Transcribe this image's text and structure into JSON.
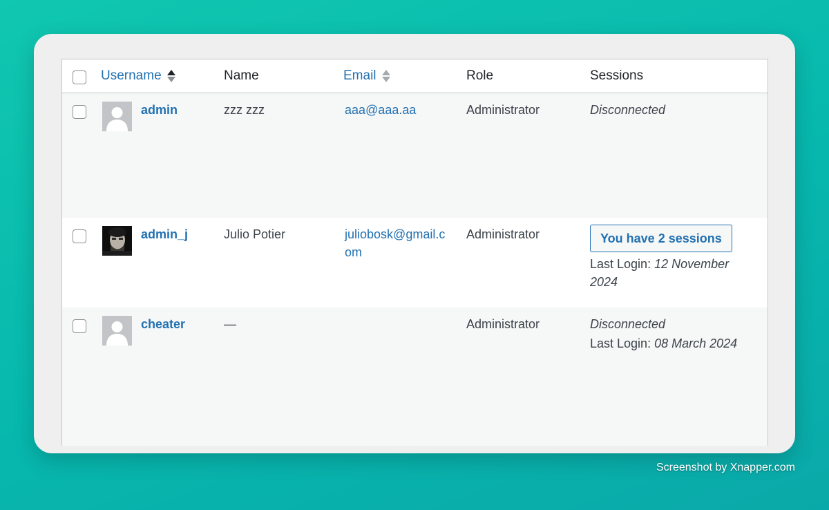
{
  "columns": {
    "username": "Username",
    "name": "Name",
    "email": "Email",
    "role": "Role",
    "sessions": "Sessions"
  },
  "rows": [
    {
      "username": "admin",
      "name": "zzz zzz",
      "email": "aaa@aaa.aa",
      "role": "Administrator",
      "session_status": "Disconnected"
    },
    {
      "username": "admin_j",
      "name": "Julio Potier",
      "email": "juliobosk@gmail.com",
      "role": "Administrator",
      "session_button": "You have 2 sessions",
      "last_login_label": "Last Login:",
      "last_login_value": "12 November 2024"
    },
    {
      "username": "cheater",
      "name": "—",
      "email": "",
      "role": "Administrator",
      "session_status": "Disconnected",
      "last_login_label": "Last Login:",
      "last_login_value": "08 March 2024"
    }
  ],
  "credit": "Screenshot by Xnapper.com",
  "colors": {
    "link": "#2271b1",
    "background_gradient": "#10c7b0",
    "frame": "#efefef"
  }
}
